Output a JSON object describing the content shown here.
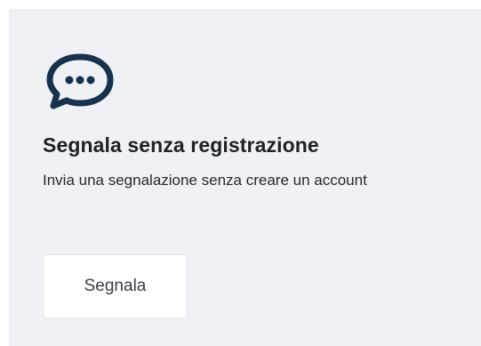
{
  "card": {
    "icon": "chat-bubble-dots-icon",
    "title": "Segnala senza registrazione",
    "description": "Invia una segnalazione senza creare un account",
    "button_label": "Segnala"
  },
  "colors": {
    "card_background": "#eff1f4",
    "icon": "#17324d",
    "title": "#1e2228",
    "text": "#26292e",
    "button_background": "#ffffff"
  }
}
